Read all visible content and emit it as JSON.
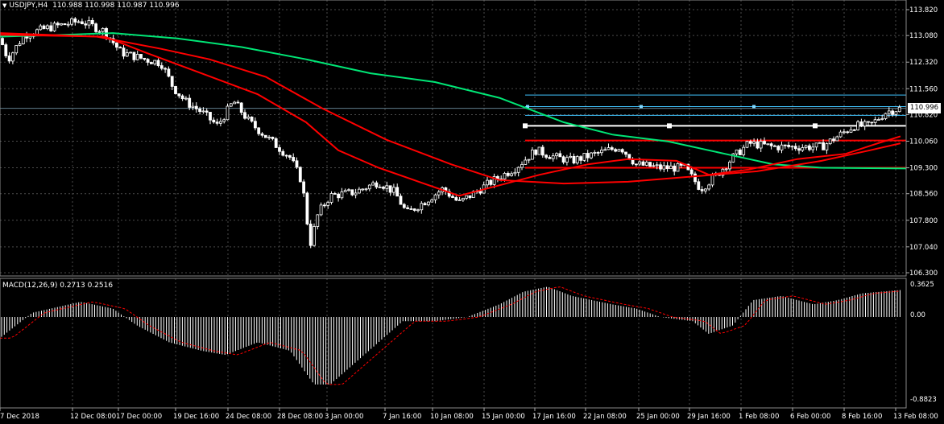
{
  "header": {
    "symbol": "USDJPY,H4",
    "ohlc": "110.988 110.998 110.987 110.996"
  },
  "macd": {
    "title": "MACD(12,26,9)",
    "values": "0.2713 0.2516",
    "axis_labels": [
      "0.3625",
      "0.00",
      "-0.8823"
    ],
    "histogram_color": "#ffffff",
    "signal_color": "#ff0000"
  },
  "price_axis": {
    "labels": [
      "113.820",
      "113.080",
      "112.320",
      "111.560",
      "110.820",
      "110.060",
      "109.300",
      "108.560",
      "107.800",
      "107.040",
      "106.300"
    ],
    "current_price": "110.996"
  },
  "time_axis": {
    "labels": [
      "7 Dec 2018",
      "12 Dec 08:00",
      "17 Dec 00:00",
      "19 Dec 16:00",
      "24 Dec 08:00",
      "28 Dec 08:00",
      "3 Jan 00:00",
      "7 Jan 16:00",
      "10 Jan 08:00",
      "15 Jan 00:00",
      "17 Jan 16:00",
      "22 Jan 08:00",
      "25 Jan 00:00",
      "29 Jan 16:00",
      "1 Feb 08:00",
      "6 Feb 00:00",
      "8 Feb 16:00",
      "13 Feb 08:00"
    ]
  },
  "colors": {
    "background": "#000000",
    "bull_candle": "#ffffff",
    "bear_candle": "#ffffff",
    "ma_fast": "#ff0000",
    "ma_slow": "#00e676",
    "grid": "#4a4a4a",
    "fib_lines": "#40c4ff",
    "support_resistance": "#ff0000",
    "white_level": "#ffffff"
  }
}
